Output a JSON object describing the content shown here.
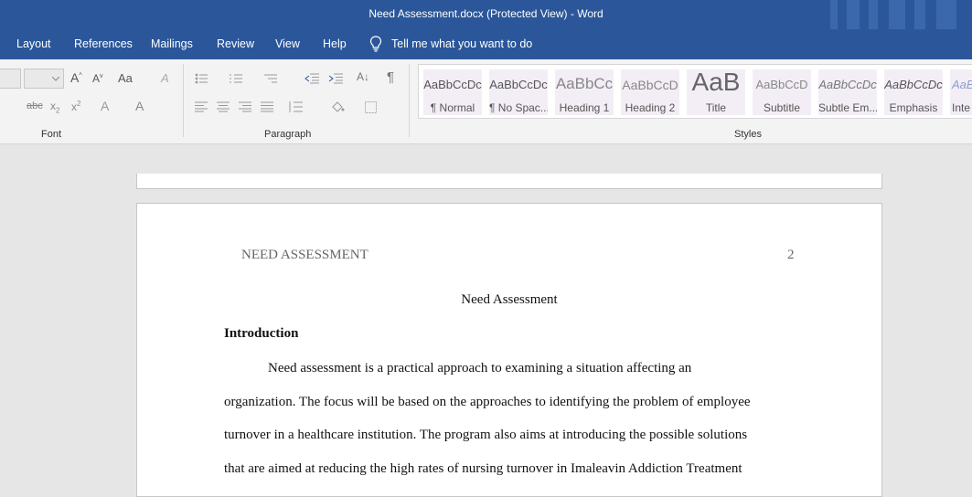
{
  "window": {
    "title": "Need Assessment.docx (Protected View)  -  Word"
  },
  "tabs": [
    "Layout",
    "References",
    "Mailings",
    "Review",
    "View",
    "Help"
  ],
  "tell_me": {
    "icon": "lightbulb-icon",
    "label": "Tell me what you want to do"
  },
  "ribbon": {
    "groups": {
      "font": "Font",
      "paragraph": "Paragraph",
      "styles": "Styles"
    },
    "font_buttons": {
      "grow": "A",
      "shrink": "A",
      "case": "Aa",
      "clear": "A",
      "strike": "abc",
      "sub": "x",
      "sub_mark": "2",
      "sup": "x",
      "sup_mark": "2",
      "effects": "A",
      "color": "A"
    },
    "paragraph_buttons": {
      "pilcrow": "¶",
      "sort": "A↓"
    },
    "styles": [
      {
        "preview": "AaBbCcDc",
        "name": "¶ Normal"
      },
      {
        "preview": "AaBbCcDc",
        "name": "¶ No Spac..."
      },
      {
        "preview": "AaBbCc",
        "name": "Heading 1"
      },
      {
        "preview": "AaBbCcD",
        "name": "Heading 2"
      },
      {
        "preview": "AaB",
        "name": "Title"
      },
      {
        "preview": "AaBbCcD",
        "name": "Subtitle"
      },
      {
        "preview": "AaBbCcDc",
        "name": "Subtle Em..."
      },
      {
        "preview": "AaBbCcDc",
        "name": "Emphasis"
      },
      {
        "preview": "AaBl",
        "name": "Inte"
      }
    ]
  },
  "document": {
    "header_text": "NEED ASSESSMENT",
    "page_number": "2",
    "title": "Need Assessment",
    "heading": "Introduction",
    "lines": [
      "Need assessment is a practical approach to examining a situation affecting an",
      "organization. The focus will be based on the approaches to identifying the problem of employee",
      "turnover in a healthcare institution. The program also aims at introducing the possible solutions",
      "that are aimed at reducing the high rates of nursing turnover in Imaleavin Addiction Treatment"
    ]
  },
  "colors": {
    "title_bar": "#2b579a",
    "ribbon": "#f3f3f3",
    "canvas": "#e6e6e6"
  }
}
